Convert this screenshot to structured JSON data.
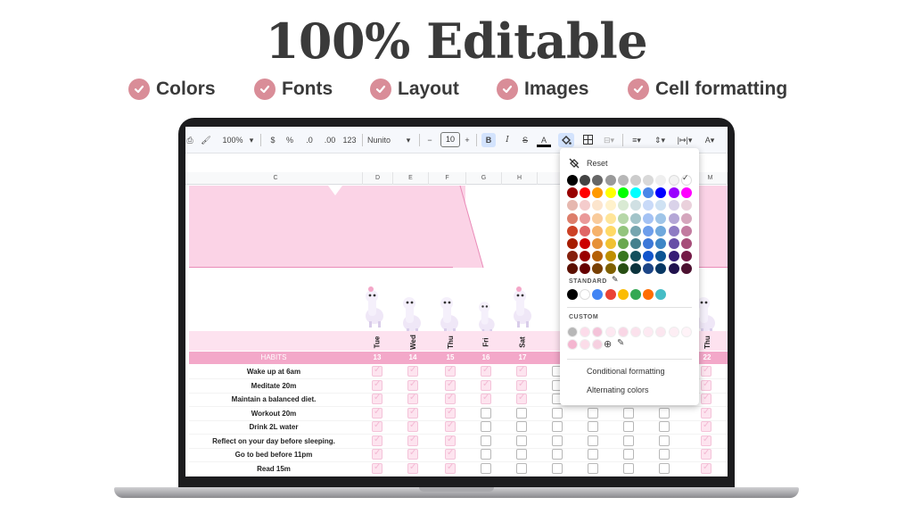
{
  "headline": "100% Editable",
  "features": [
    {
      "label": "Colors"
    },
    {
      "label": "Fonts"
    },
    {
      "label": "Layout"
    },
    {
      "label": "Images"
    },
    {
      "label": "Cell formatting"
    }
  ],
  "toolbar": {
    "zoom": "100%",
    "currency": "$",
    "percent": "%",
    "dec_decrease": ".0",
    "dec_increase": ".00",
    "number_format": "123",
    "font": "Nunito",
    "minus": "−",
    "font_size": "10",
    "plus": "+",
    "bold": "B",
    "italic": "I",
    "strike": "S",
    "text_color": "A"
  },
  "columns": [
    "C",
    "D",
    "E",
    "F",
    "G",
    "H",
    "M"
  ],
  "days": [
    "Tue",
    "Wed",
    "Thu",
    "Fri",
    "Sat",
    "Thu"
  ],
  "habits_header": "HABITS",
  "day_numbers": [
    "13",
    "14",
    "15",
    "16",
    "17",
    "22"
  ],
  "habits": [
    "Wake up at 6am",
    "Meditate 20m",
    "Maintain a balanced diet.",
    "Workout 20m",
    "Drink 2L water",
    "Reflect on your day before sleeping.",
    "Go to bed before 11pm",
    "Read 15m"
  ],
  "color_menu": {
    "reset_label": "Reset",
    "standard_label": "STANDARD",
    "custom_label": "CUSTOM",
    "conditional_formatting": "Conditional formatting",
    "alternating_colors": "Alternating colors"
  },
  "colors": {
    "accent_pink": "#d98d98",
    "banner_pink": "#fbd3e6",
    "header_pink": "#f3a8c9"
  }
}
